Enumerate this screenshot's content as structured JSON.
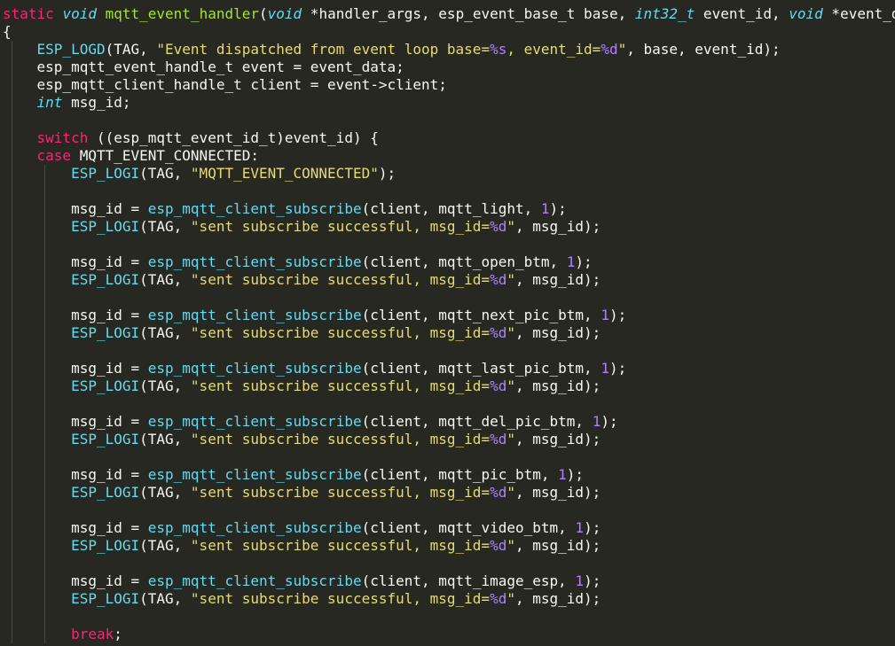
{
  "colors": {
    "background": "#272822",
    "keyword": "#f92672",
    "type": "#66d9ef",
    "function_name": "#a6e22e",
    "string": "#e6db74",
    "number": "#ae81ff",
    "plain": "#f8f8f2"
  },
  "code_lines": [
    {
      "indent": 0,
      "tokens": [
        {
          "t": "kw",
          "v": "static"
        },
        {
          "t": "txt",
          "v": " "
        },
        {
          "t": "ty",
          "v": "void"
        },
        {
          "t": "txt",
          "v": " "
        },
        {
          "t": "fn",
          "v": "mqtt_event_handler"
        },
        {
          "t": "txt",
          "v": "("
        },
        {
          "t": "ty",
          "v": "void"
        },
        {
          "t": "txt",
          "v": " *handler_args, esp_event_base_t base, "
        },
        {
          "t": "ty",
          "v": "int32_t"
        },
        {
          "t": "txt",
          "v": " event_id, "
        },
        {
          "t": "ty",
          "v": "void"
        },
        {
          "t": "txt",
          "v": " *event_data"
        }
      ]
    },
    {
      "indent": 0,
      "tokens": [
        {
          "t": "txt",
          "v": "{"
        }
      ]
    },
    {
      "indent": 1,
      "tokens": [
        {
          "t": "mac",
          "v": "ESP_LOGD"
        },
        {
          "t": "txt",
          "v": "(TAG, "
        },
        {
          "t": "str",
          "v": "\"Event dispatched from event loop base="
        },
        {
          "t": "fmt",
          "v": "%s"
        },
        {
          "t": "str",
          "v": ", event_id="
        },
        {
          "t": "fmt",
          "v": "%d"
        },
        {
          "t": "str",
          "v": "\""
        },
        {
          "t": "txt",
          "v": ", base, event_id);"
        }
      ]
    },
    {
      "indent": 1,
      "tokens": [
        {
          "t": "txt",
          "v": "esp_mqtt_event_handle_t event = event_data;"
        }
      ]
    },
    {
      "indent": 1,
      "tokens": [
        {
          "t": "txt",
          "v": "esp_mqtt_client_handle_t client = event->client;"
        }
      ]
    },
    {
      "indent": 1,
      "tokens": [
        {
          "t": "ty",
          "v": "int"
        },
        {
          "t": "txt",
          "v": " msg_id;"
        }
      ]
    },
    {
      "indent": 1,
      "tokens": []
    },
    {
      "indent": 1,
      "tokens": [
        {
          "t": "kw",
          "v": "switch"
        },
        {
          "t": "txt",
          "v": " ((esp_mqtt_event_id_t)event_id) {"
        }
      ]
    },
    {
      "indent": 1,
      "tokens": [
        {
          "t": "kw",
          "v": "case"
        },
        {
          "t": "txt",
          "v": " MQTT_EVENT_CONNECTED:"
        }
      ]
    },
    {
      "indent": 2,
      "tokens": [
        {
          "t": "mac",
          "v": "ESP_LOGI"
        },
        {
          "t": "txt",
          "v": "(TAG, "
        },
        {
          "t": "str",
          "v": "\"MQTT_EVENT_CONNECTED\""
        },
        {
          "t": "txt",
          "v": ");"
        }
      ]
    },
    {
      "indent": 2,
      "tokens": []
    },
    {
      "indent": 2,
      "tokens": [
        {
          "t": "txt",
          "v": "msg_id = "
        },
        {
          "t": "call",
          "v": "esp_mqtt_client_subscribe"
        },
        {
          "t": "txt",
          "v": "(client, mqtt_light, "
        },
        {
          "t": "num",
          "v": "1"
        },
        {
          "t": "txt",
          "v": ");"
        }
      ]
    },
    {
      "indent": 2,
      "tokens": [
        {
          "t": "mac",
          "v": "ESP_LOGI"
        },
        {
          "t": "txt",
          "v": "(TAG, "
        },
        {
          "t": "str",
          "v": "\"sent subscribe successful, msg_id="
        },
        {
          "t": "fmt",
          "v": "%d"
        },
        {
          "t": "str",
          "v": "\""
        },
        {
          "t": "txt",
          "v": ", msg_id);"
        }
      ]
    },
    {
      "indent": 2,
      "tokens": []
    },
    {
      "indent": 2,
      "tokens": [
        {
          "t": "txt",
          "v": "msg_id = "
        },
        {
          "t": "call",
          "v": "esp_mqtt_client_subscribe"
        },
        {
          "t": "txt",
          "v": "(client, mqtt_open_btm, "
        },
        {
          "t": "num",
          "v": "1"
        },
        {
          "t": "txt",
          "v": ");"
        }
      ]
    },
    {
      "indent": 2,
      "tokens": [
        {
          "t": "mac",
          "v": "ESP_LOGI"
        },
        {
          "t": "txt",
          "v": "(TAG, "
        },
        {
          "t": "str",
          "v": "\"sent subscribe successful, msg_id="
        },
        {
          "t": "fmt",
          "v": "%d"
        },
        {
          "t": "str",
          "v": "\""
        },
        {
          "t": "txt",
          "v": ", msg_id);"
        }
      ]
    },
    {
      "indent": 2,
      "tokens": []
    },
    {
      "indent": 2,
      "tokens": [
        {
          "t": "txt",
          "v": "msg_id = "
        },
        {
          "t": "call",
          "v": "esp_mqtt_client_subscribe"
        },
        {
          "t": "txt",
          "v": "(client, mqtt_next_pic_btm, "
        },
        {
          "t": "num",
          "v": "1"
        },
        {
          "t": "txt",
          "v": ");"
        }
      ]
    },
    {
      "indent": 2,
      "tokens": [
        {
          "t": "mac",
          "v": "ESP_LOGI"
        },
        {
          "t": "txt",
          "v": "(TAG, "
        },
        {
          "t": "str",
          "v": "\"sent subscribe successful, msg_id="
        },
        {
          "t": "fmt",
          "v": "%d"
        },
        {
          "t": "str",
          "v": "\""
        },
        {
          "t": "txt",
          "v": ", msg_id);"
        }
      ]
    },
    {
      "indent": 2,
      "tokens": []
    },
    {
      "indent": 2,
      "tokens": [
        {
          "t": "txt",
          "v": "msg_id = "
        },
        {
          "t": "call",
          "v": "esp_mqtt_client_subscribe"
        },
        {
          "t": "txt",
          "v": "(client, mqtt_last_pic_btm, "
        },
        {
          "t": "num",
          "v": "1"
        },
        {
          "t": "txt",
          "v": ");"
        }
      ]
    },
    {
      "indent": 2,
      "tokens": [
        {
          "t": "mac",
          "v": "ESP_LOGI"
        },
        {
          "t": "txt",
          "v": "(TAG, "
        },
        {
          "t": "str",
          "v": "\"sent subscribe successful, msg_id="
        },
        {
          "t": "fmt",
          "v": "%d"
        },
        {
          "t": "str",
          "v": "\""
        },
        {
          "t": "txt",
          "v": ", msg_id);"
        }
      ]
    },
    {
      "indent": 2,
      "tokens": []
    },
    {
      "indent": 2,
      "tokens": [
        {
          "t": "txt",
          "v": "msg_id = "
        },
        {
          "t": "call",
          "v": "esp_mqtt_client_subscribe"
        },
        {
          "t": "txt",
          "v": "(client, mqtt_del_pic_btm, "
        },
        {
          "t": "num",
          "v": "1"
        },
        {
          "t": "txt",
          "v": ");"
        }
      ]
    },
    {
      "indent": 2,
      "tokens": [
        {
          "t": "mac",
          "v": "ESP_LOGI"
        },
        {
          "t": "txt",
          "v": "(TAG, "
        },
        {
          "t": "str",
          "v": "\"sent subscribe successful, msg_id="
        },
        {
          "t": "fmt",
          "v": "%d"
        },
        {
          "t": "str",
          "v": "\""
        },
        {
          "t": "txt",
          "v": ", msg_id);"
        }
      ]
    },
    {
      "indent": 2,
      "tokens": []
    },
    {
      "indent": 2,
      "tokens": [
        {
          "t": "txt",
          "v": "msg_id = "
        },
        {
          "t": "call",
          "v": "esp_mqtt_client_subscribe"
        },
        {
          "t": "txt",
          "v": "(client, mqtt_pic_btm, "
        },
        {
          "t": "num",
          "v": "1"
        },
        {
          "t": "txt",
          "v": ");"
        }
      ]
    },
    {
      "indent": 2,
      "tokens": [
        {
          "t": "mac",
          "v": "ESP_LOGI"
        },
        {
          "t": "txt",
          "v": "(TAG, "
        },
        {
          "t": "str",
          "v": "\"sent subscribe successful, msg_id="
        },
        {
          "t": "fmt",
          "v": "%d"
        },
        {
          "t": "str",
          "v": "\""
        },
        {
          "t": "txt",
          "v": ", msg_id);"
        }
      ]
    },
    {
      "indent": 2,
      "tokens": []
    },
    {
      "indent": 2,
      "tokens": [
        {
          "t": "txt",
          "v": "msg_id = "
        },
        {
          "t": "call",
          "v": "esp_mqtt_client_subscribe"
        },
        {
          "t": "txt",
          "v": "(client, mqtt_video_btm, "
        },
        {
          "t": "num",
          "v": "1"
        },
        {
          "t": "txt",
          "v": ");"
        }
      ]
    },
    {
      "indent": 2,
      "tokens": [
        {
          "t": "mac",
          "v": "ESP_LOGI"
        },
        {
          "t": "txt",
          "v": "(TAG, "
        },
        {
          "t": "str",
          "v": "\"sent subscribe successful, msg_id="
        },
        {
          "t": "fmt",
          "v": "%d"
        },
        {
          "t": "str",
          "v": "\""
        },
        {
          "t": "txt",
          "v": ", msg_id);"
        }
      ]
    },
    {
      "indent": 2,
      "tokens": []
    },
    {
      "indent": 2,
      "tokens": [
        {
          "t": "txt",
          "v": "msg_id = "
        },
        {
          "t": "call",
          "v": "esp_mqtt_client_subscribe"
        },
        {
          "t": "txt",
          "v": "(client, mqtt_image_esp, "
        },
        {
          "t": "num",
          "v": "1"
        },
        {
          "t": "txt",
          "v": ");"
        }
      ]
    },
    {
      "indent": 2,
      "tokens": [
        {
          "t": "mac",
          "v": "ESP_LOGI"
        },
        {
          "t": "txt",
          "v": "(TAG, "
        },
        {
          "t": "str",
          "v": "\"sent subscribe successful, msg_id="
        },
        {
          "t": "fmt",
          "v": "%d"
        },
        {
          "t": "str",
          "v": "\""
        },
        {
          "t": "txt",
          "v": ", msg_id);"
        }
      ]
    },
    {
      "indent": 2,
      "tokens": []
    },
    {
      "indent": 2,
      "tokens": [
        {
          "t": "kw",
          "v": "break"
        },
        {
          "t": "txt",
          "v": ";"
        }
      ]
    }
  ]
}
